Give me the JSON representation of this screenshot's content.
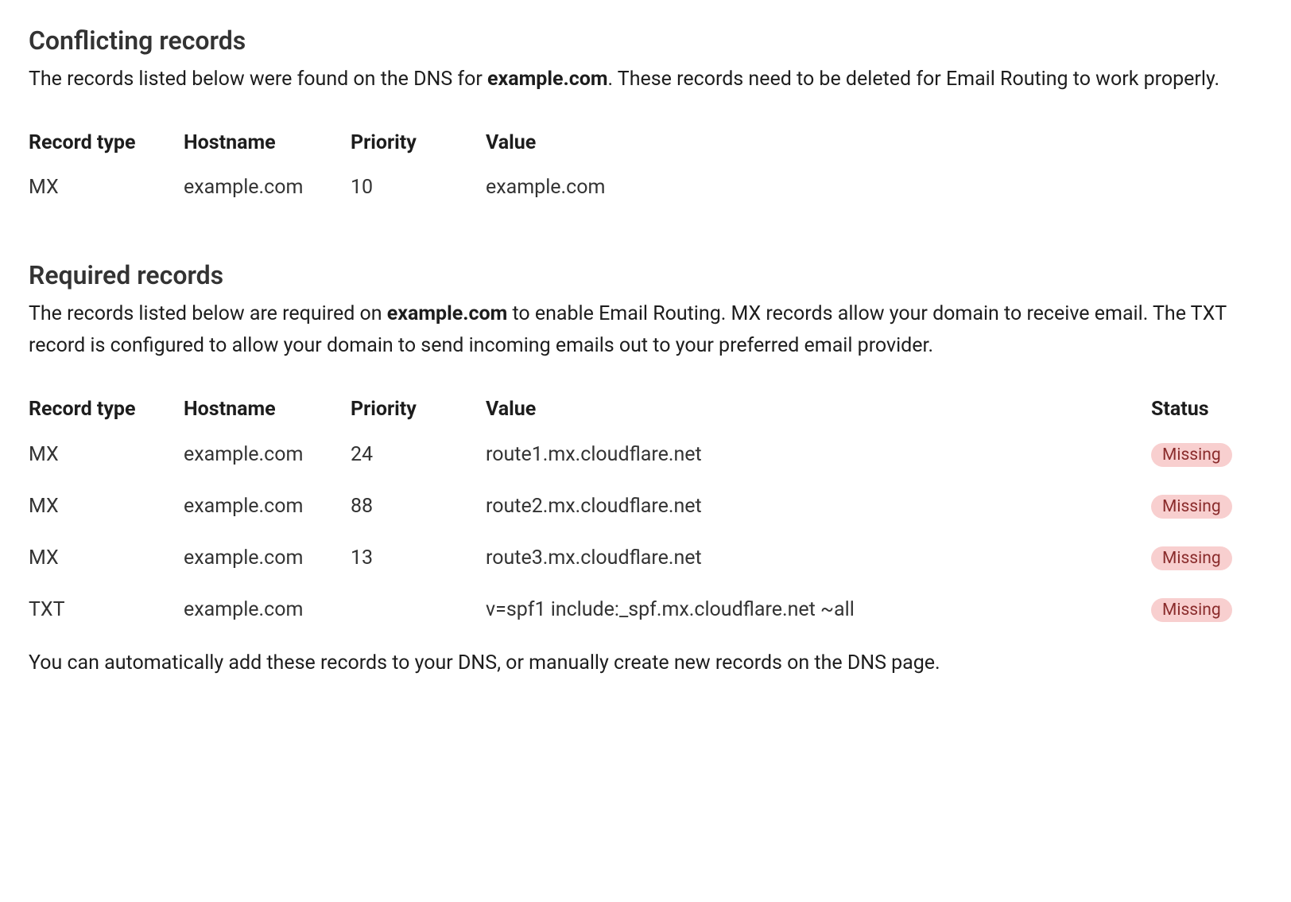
{
  "conflicting": {
    "title": "Conflicting records",
    "desc_prefix": "The records listed below were found on the DNS for ",
    "desc_domain": "example.com",
    "desc_suffix": ". These records need to be deleted for Email Routing to work properly.",
    "headers": {
      "type": "Record type",
      "hostname": "Hostname",
      "priority": "Priority",
      "value": "Value"
    },
    "rows": [
      {
        "type": "MX",
        "hostname": "example.com",
        "priority": "10",
        "value": "example.com"
      }
    ]
  },
  "required": {
    "title": "Required records",
    "desc_prefix": "The records listed below are required on ",
    "desc_domain": "example.com",
    "desc_suffix": " to enable Email Routing. MX records allow your domain to receive email. The TXT record is configured to allow your domain to send incoming emails out to your preferred email provider.",
    "headers": {
      "type": "Record type",
      "hostname": "Hostname",
      "priority": "Priority",
      "value": "Value",
      "status": "Status"
    },
    "rows": [
      {
        "type": "MX",
        "hostname": "example.com",
        "priority": "24",
        "value": "route1.mx.cloudflare.net",
        "status": "Missing"
      },
      {
        "type": "MX",
        "hostname": "example.com",
        "priority": "88",
        "value": "route2.mx.cloudflare.net",
        "status": "Missing"
      },
      {
        "type": "MX",
        "hostname": "example.com",
        "priority": "13",
        "value": "route3.mx.cloudflare.net",
        "status": "Missing"
      },
      {
        "type": "TXT",
        "hostname": "example.com",
        "priority": "",
        "value": "v=spf1 include:_spf.mx.cloudflare.net ~all",
        "status": "Missing"
      }
    ],
    "footer": "You can automatically add these records to your DNS, or manually create new records on the DNS page."
  }
}
